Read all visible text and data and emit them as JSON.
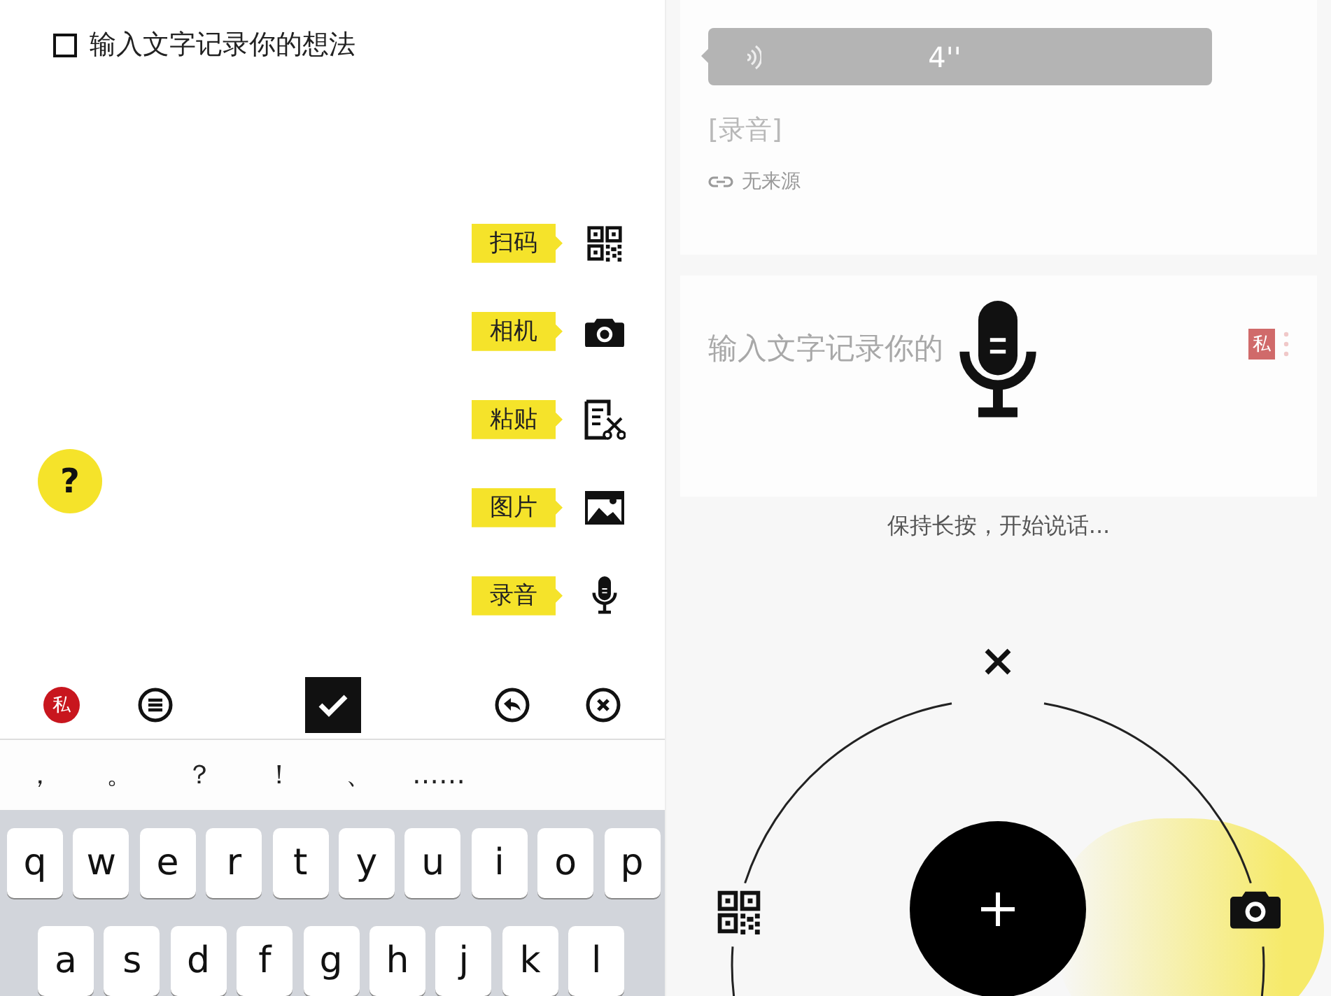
{
  "editor": {
    "checkbox": {
      "checked": false
    },
    "placeholder": "输入文字记录你的想法",
    "quick_actions": [
      {
        "kind": "scan",
        "label": "扫码"
      },
      {
        "kind": "camera",
        "label": "相机"
      },
      {
        "kind": "paste",
        "label": "粘贴"
      },
      {
        "kind": "image",
        "label": "图片"
      },
      {
        "kind": "record",
        "label": "录音"
      }
    ],
    "help": "?",
    "toolbar": [
      {
        "kind": "private",
        "label": "私"
      },
      {
        "kind": "list"
      },
      {
        "kind": "confirm"
      },
      {
        "kind": "undo"
      },
      {
        "kind": "clear"
      }
    ]
  },
  "keyboard": {
    "suggestions": [
      "，",
      "。",
      "？",
      "！",
      "、",
      "……"
    ],
    "rows": [
      [
        "q",
        "w",
        "e",
        "r",
        "t",
        "y",
        "u",
        "i",
        "o",
        "p"
      ],
      [
        "a",
        "s",
        "d",
        "f",
        "g",
        "h",
        "j",
        "k",
        "l"
      ]
    ]
  },
  "voice": {
    "note_card": {
      "duration": "4''",
      "text": "[录音]",
      "source": "无来源"
    },
    "draft_card": {
      "title": "输入文字记录你的",
      "badge": "私"
    },
    "hint": "保持长按，开始说话..."
  }
}
